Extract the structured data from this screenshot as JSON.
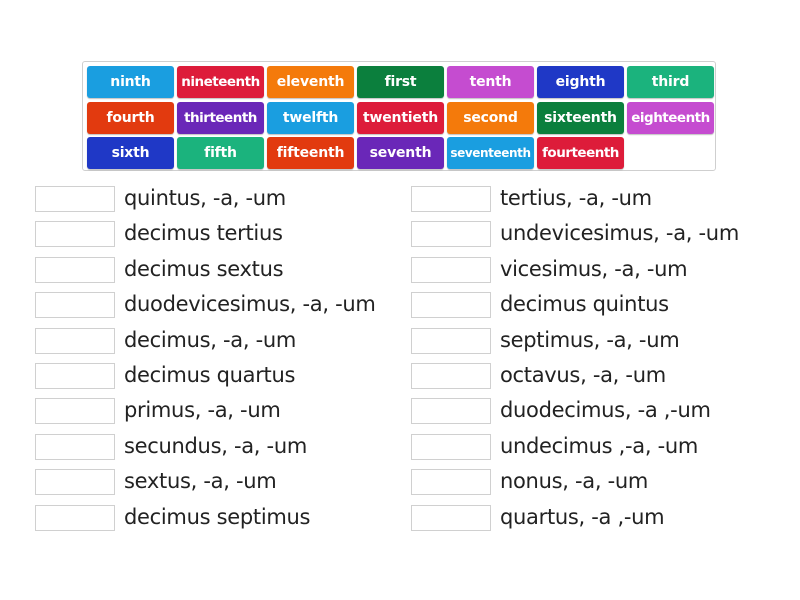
{
  "word_bank": {
    "tiles": [
      {
        "label": "ninth",
        "color": "#1a9ee0"
      },
      {
        "label": "nineteenth",
        "color": "#dd1c3a"
      },
      {
        "label": "eleventh",
        "color": "#f47a0b"
      },
      {
        "label": "first",
        "color": "#0b7f3d"
      },
      {
        "label": "tenth",
        "color": "#c54cd0"
      },
      {
        "label": "eighth",
        "color": "#1f38c6"
      },
      {
        "label": "third",
        "color": "#1bb37d"
      },
      {
        "label": "fourth",
        "color": "#e23a0f"
      },
      {
        "label": "thirteenth",
        "color": "#6a27b8"
      },
      {
        "label": "twelfth",
        "color": "#1a9ee0"
      },
      {
        "label": "twentieth",
        "color": "#dd1c3a"
      },
      {
        "label": "second",
        "color": "#f47a0b"
      },
      {
        "label": "sixteenth",
        "color": "#0b7f3d"
      },
      {
        "label": "eighteenth",
        "color": "#c54cd0"
      },
      {
        "label": "sixth",
        "color": "#1f38c6"
      },
      {
        "label": "fifth",
        "color": "#1bb37d"
      },
      {
        "label": "fifteenth",
        "color": "#e23a0f"
      },
      {
        "label": "seventh",
        "color": "#6a27b8"
      },
      {
        "label": "seventeenth",
        "color": "#1a9ee0"
      },
      {
        "label": "fourteenth",
        "color": "#dd1c3a"
      }
    ]
  },
  "matching": {
    "left_column": [
      {
        "clue": "quintus, -a, -um",
        "answer": ""
      },
      {
        "clue": "decimus tertius",
        "answer": ""
      },
      {
        "clue": "decimus sextus",
        "answer": ""
      },
      {
        "clue": "duodevicesimus, -a, -um",
        "answer": ""
      },
      {
        "clue": "decimus, -a, -um",
        "answer": ""
      },
      {
        "clue": "decimus quartus",
        "answer": ""
      },
      {
        "clue": "primus, -a, -um",
        "answer": ""
      },
      {
        "clue": "secundus, -a, -um",
        "answer": ""
      },
      {
        "clue": "sextus, -a, -um",
        "answer": ""
      },
      {
        "clue": "decimus septimus",
        "answer": ""
      }
    ],
    "right_column": [
      {
        "clue": "tertius, -a, -um",
        "answer": ""
      },
      {
        "clue": "undevicesimus, -a, -um",
        "answer": ""
      },
      {
        "clue": "vicesimus, -a, -um",
        "answer": ""
      },
      {
        "clue": "decimus quintus",
        "answer": ""
      },
      {
        "clue": "septimus, -a, -um",
        "answer": ""
      },
      {
        "clue": "octavus, -a, -um",
        "answer": ""
      },
      {
        "clue": "duodecimus, -a ,-um",
        "answer": ""
      },
      {
        "clue": "undecimus ,-a, -um",
        "answer": ""
      },
      {
        "clue": "nonus, -a, -um",
        "answer": ""
      },
      {
        "clue": "quartus, -a ,-um",
        "answer": ""
      }
    ]
  }
}
